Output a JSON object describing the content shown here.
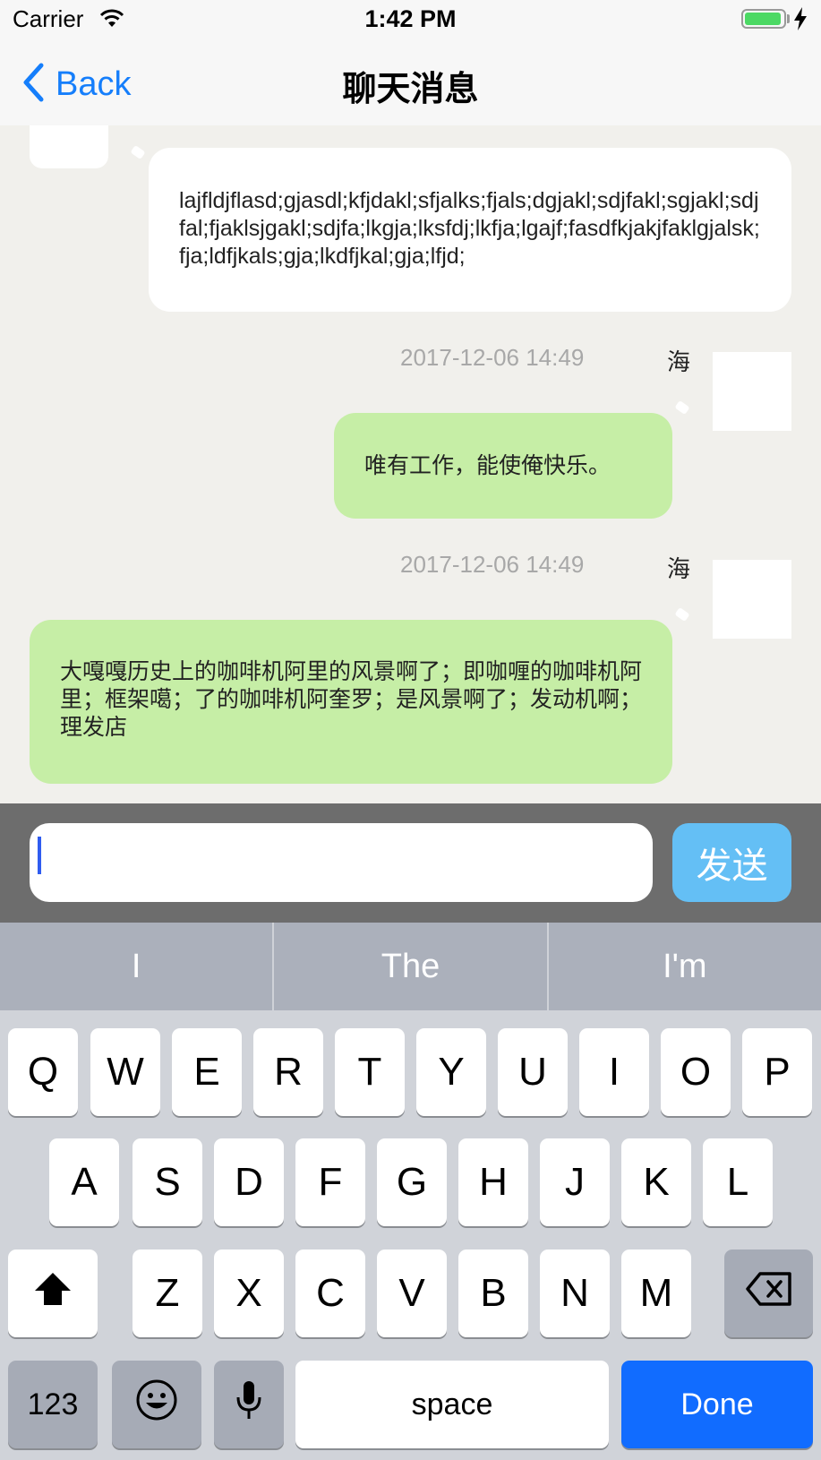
{
  "status_bar": {
    "carrier": "Carrier",
    "time": "1:42 PM"
  },
  "nav": {
    "back_label": "Back",
    "title": "聊天消息"
  },
  "messages": [
    {
      "text": "lajfldjflasd;gjasdl;kfjdakl;sfjalks;fjals;dgjakl;sdjfakl;sgjakl;sdjfal;fjaklsjgakl;sdjfa;lkgja;lksfdj;lkfja;lgajf;fasdfkjakjfaklgjalsk;fja;ldfjkals;gja;lkdfjkal;gja;lfjd;"
    },
    {
      "timestamp": "2017-12-06 14:49",
      "sender": "海",
      "text": "唯有工作，能使俺快乐。"
    },
    {
      "timestamp": "2017-12-06 14:49",
      "sender": "海",
      "text": "大嘎嘎历史上的咖啡机阿里的风景啊了；即咖喱的咖啡机阿里；框架噶；了的咖啡机阿奎罗；是风景啊了；发动机啊；理发店"
    }
  ],
  "input": {
    "value": "",
    "send_label": "发送"
  },
  "suggestions": [
    "I",
    "The",
    "I'm"
  ],
  "keyboard": {
    "row1": [
      "Q",
      "W",
      "E",
      "R",
      "T",
      "Y",
      "U",
      "I",
      "O",
      "P"
    ],
    "row2": [
      "A",
      "S",
      "D",
      "F",
      "G",
      "H",
      "J",
      "K",
      "L"
    ],
    "row3": [
      "Z",
      "X",
      "C",
      "V",
      "B",
      "N",
      "M"
    ],
    "numbers_label": "123",
    "space_label": "space",
    "done_label": "Done"
  },
  "colors": {
    "accent": "#157efb",
    "bubble_green": "#c6eea6",
    "send_button": "#64bff5",
    "done_key": "#116cff"
  }
}
